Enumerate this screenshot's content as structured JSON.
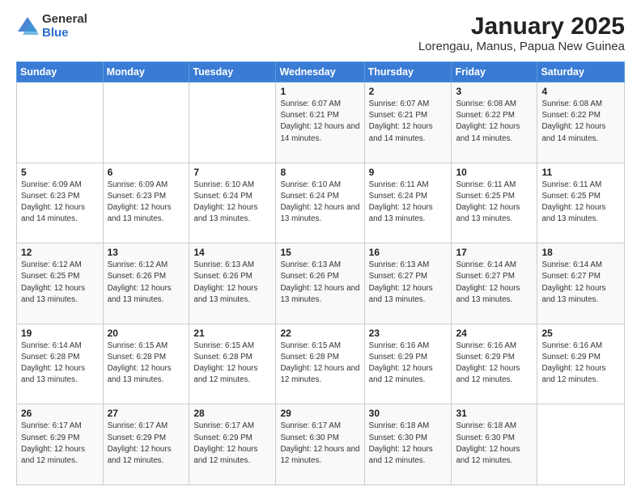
{
  "logo": {
    "general": "General",
    "blue": "Blue"
  },
  "header": {
    "month": "January 2025",
    "location": "Lorengau, Manus, Papua New Guinea"
  },
  "days_of_week": [
    "Sunday",
    "Monday",
    "Tuesday",
    "Wednesday",
    "Thursday",
    "Friday",
    "Saturday"
  ],
  "weeks": [
    [
      {
        "day": "",
        "info": ""
      },
      {
        "day": "",
        "info": ""
      },
      {
        "day": "",
        "info": ""
      },
      {
        "day": "1",
        "info": "Sunrise: 6:07 AM\nSunset: 6:21 PM\nDaylight: 12 hours and 14 minutes."
      },
      {
        "day": "2",
        "info": "Sunrise: 6:07 AM\nSunset: 6:21 PM\nDaylight: 12 hours and 14 minutes."
      },
      {
        "day": "3",
        "info": "Sunrise: 6:08 AM\nSunset: 6:22 PM\nDaylight: 12 hours and 14 minutes."
      },
      {
        "day": "4",
        "info": "Sunrise: 6:08 AM\nSunset: 6:22 PM\nDaylight: 12 hours and 14 minutes."
      }
    ],
    [
      {
        "day": "5",
        "info": "Sunrise: 6:09 AM\nSunset: 6:23 PM\nDaylight: 12 hours and 14 minutes."
      },
      {
        "day": "6",
        "info": "Sunrise: 6:09 AM\nSunset: 6:23 PM\nDaylight: 12 hours and 13 minutes."
      },
      {
        "day": "7",
        "info": "Sunrise: 6:10 AM\nSunset: 6:24 PM\nDaylight: 12 hours and 13 minutes."
      },
      {
        "day": "8",
        "info": "Sunrise: 6:10 AM\nSunset: 6:24 PM\nDaylight: 12 hours and 13 minutes."
      },
      {
        "day": "9",
        "info": "Sunrise: 6:11 AM\nSunset: 6:24 PM\nDaylight: 12 hours and 13 minutes."
      },
      {
        "day": "10",
        "info": "Sunrise: 6:11 AM\nSunset: 6:25 PM\nDaylight: 12 hours and 13 minutes."
      },
      {
        "day": "11",
        "info": "Sunrise: 6:11 AM\nSunset: 6:25 PM\nDaylight: 12 hours and 13 minutes."
      }
    ],
    [
      {
        "day": "12",
        "info": "Sunrise: 6:12 AM\nSunset: 6:25 PM\nDaylight: 12 hours and 13 minutes."
      },
      {
        "day": "13",
        "info": "Sunrise: 6:12 AM\nSunset: 6:26 PM\nDaylight: 12 hours and 13 minutes."
      },
      {
        "day": "14",
        "info": "Sunrise: 6:13 AM\nSunset: 6:26 PM\nDaylight: 12 hours and 13 minutes."
      },
      {
        "day": "15",
        "info": "Sunrise: 6:13 AM\nSunset: 6:26 PM\nDaylight: 12 hours and 13 minutes."
      },
      {
        "day": "16",
        "info": "Sunrise: 6:13 AM\nSunset: 6:27 PM\nDaylight: 12 hours and 13 minutes."
      },
      {
        "day": "17",
        "info": "Sunrise: 6:14 AM\nSunset: 6:27 PM\nDaylight: 12 hours and 13 minutes."
      },
      {
        "day": "18",
        "info": "Sunrise: 6:14 AM\nSunset: 6:27 PM\nDaylight: 12 hours and 13 minutes."
      }
    ],
    [
      {
        "day": "19",
        "info": "Sunrise: 6:14 AM\nSunset: 6:28 PM\nDaylight: 12 hours and 13 minutes."
      },
      {
        "day": "20",
        "info": "Sunrise: 6:15 AM\nSunset: 6:28 PM\nDaylight: 12 hours and 13 minutes."
      },
      {
        "day": "21",
        "info": "Sunrise: 6:15 AM\nSunset: 6:28 PM\nDaylight: 12 hours and 12 minutes."
      },
      {
        "day": "22",
        "info": "Sunrise: 6:15 AM\nSunset: 6:28 PM\nDaylight: 12 hours and 12 minutes."
      },
      {
        "day": "23",
        "info": "Sunrise: 6:16 AM\nSunset: 6:29 PM\nDaylight: 12 hours and 12 minutes."
      },
      {
        "day": "24",
        "info": "Sunrise: 6:16 AM\nSunset: 6:29 PM\nDaylight: 12 hours and 12 minutes."
      },
      {
        "day": "25",
        "info": "Sunrise: 6:16 AM\nSunset: 6:29 PM\nDaylight: 12 hours and 12 minutes."
      }
    ],
    [
      {
        "day": "26",
        "info": "Sunrise: 6:17 AM\nSunset: 6:29 PM\nDaylight: 12 hours and 12 minutes."
      },
      {
        "day": "27",
        "info": "Sunrise: 6:17 AM\nSunset: 6:29 PM\nDaylight: 12 hours and 12 minutes."
      },
      {
        "day": "28",
        "info": "Sunrise: 6:17 AM\nSunset: 6:29 PM\nDaylight: 12 hours and 12 minutes."
      },
      {
        "day": "29",
        "info": "Sunrise: 6:17 AM\nSunset: 6:30 PM\nDaylight: 12 hours and 12 minutes."
      },
      {
        "day": "30",
        "info": "Sunrise: 6:18 AM\nSunset: 6:30 PM\nDaylight: 12 hours and 12 minutes."
      },
      {
        "day": "31",
        "info": "Sunrise: 6:18 AM\nSunset: 6:30 PM\nDaylight: 12 hours and 12 minutes."
      },
      {
        "day": "",
        "info": ""
      }
    ]
  ]
}
